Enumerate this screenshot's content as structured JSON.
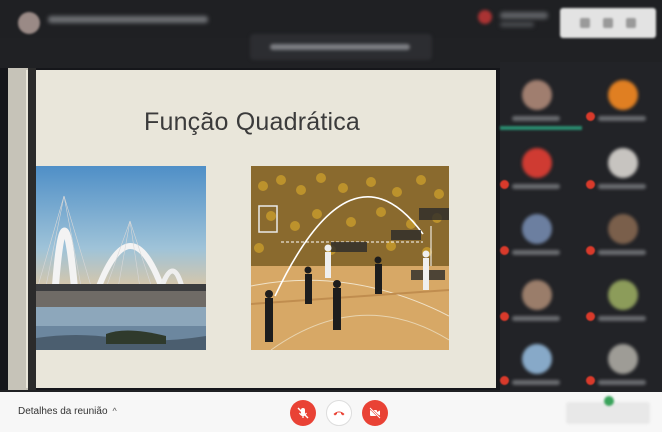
{
  "slide": {
    "title": "Função Quadrática"
  },
  "bottom_bar": {
    "details_label": "Detalhes da reunião",
    "details_chevron": "^"
  },
  "controls": {
    "mic_icon": "mic-off-icon",
    "hangup_icon": "call-end-icon",
    "camera_icon": "videocam-off-icon"
  },
  "colors": {
    "danger": "#e94235",
    "slide_background": "#e9e6da",
    "meeting_background": "#202124"
  },
  "participants": [
    {
      "avatar_color": "#a07e6f",
      "muted": false
    },
    {
      "avatar_color": "#e07f22",
      "muted": true
    },
    {
      "avatar_color": "#cf3b32",
      "muted": true
    },
    {
      "avatar_color": "#c7c4c0",
      "muted": true
    },
    {
      "avatar_color": "#6c7fa0",
      "muted": true
    },
    {
      "avatar_color": "#7a5f4b",
      "muted": true
    },
    {
      "avatar_color": "#9a7d6a",
      "muted": true
    },
    {
      "avatar_color": "#8c9c5a",
      "muted": true
    },
    {
      "avatar_color": "#87a9c8",
      "muted": true
    },
    {
      "avatar_color": "#9e9c96",
      "muted": true
    }
  ]
}
